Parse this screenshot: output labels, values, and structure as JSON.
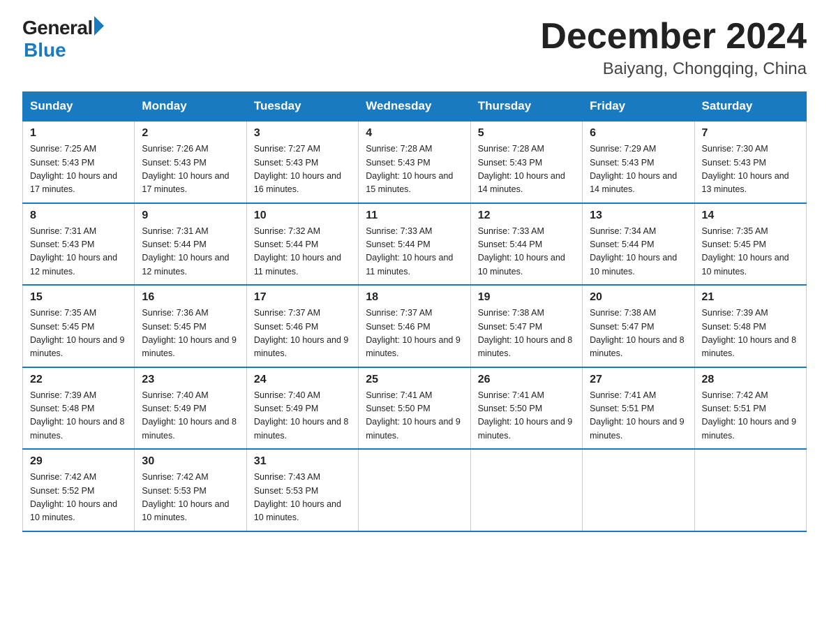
{
  "logo": {
    "general": "General",
    "blue": "Blue"
  },
  "header": {
    "month": "December 2024",
    "location": "Baiyang, Chongqing, China"
  },
  "days_of_week": [
    "Sunday",
    "Monday",
    "Tuesday",
    "Wednesday",
    "Thursday",
    "Friday",
    "Saturday"
  ],
  "weeks": [
    [
      {
        "day": "1",
        "sunrise": "7:25 AM",
        "sunset": "5:43 PM",
        "daylight": "10 hours and 17 minutes."
      },
      {
        "day": "2",
        "sunrise": "7:26 AM",
        "sunset": "5:43 PM",
        "daylight": "10 hours and 17 minutes."
      },
      {
        "day": "3",
        "sunrise": "7:27 AM",
        "sunset": "5:43 PM",
        "daylight": "10 hours and 16 minutes."
      },
      {
        "day": "4",
        "sunrise": "7:28 AM",
        "sunset": "5:43 PM",
        "daylight": "10 hours and 15 minutes."
      },
      {
        "day": "5",
        "sunrise": "7:28 AM",
        "sunset": "5:43 PM",
        "daylight": "10 hours and 14 minutes."
      },
      {
        "day": "6",
        "sunrise": "7:29 AM",
        "sunset": "5:43 PM",
        "daylight": "10 hours and 14 minutes."
      },
      {
        "day": "7",
        "sunrise": "7:30 AM",
        "sunset": "5:43 PM",
        "daylight": "10 hours and 13 minutes."
      }
    ],
    [
      {
        "day": "8",
        "sunrise": "7:31 AM",
        "sunset": "5:43 PM",
        "daylight": "10 hours and 12 minutes."
      },
      {
        "day": "9",
        "sunrise": "7:31 AM",
        "sunset": "5:44 PM",
        "daylight": "10 hours and 12 minutes."
      },
      {
        "day": "10",
        "sunrise": "7:32 AM",
        "sunset": "5:44 PM",
        "daylight": "10 hours and 11 minutes."
      },
      {
        "day": "11",
        "sunrise": "7:33 AM",
        "sunset": "5:44 PM",
        "daylight": "10 hours and 11 minutes."
      },
      {
        "day": "12",
        "sunrise": "7:33 AM",
        "sunset": "5:44 PM",
        "daylight": "10 hours and 10 minutes."
      },
      {
        "day": "13",
        "sunrise": "7:34 AM",
        "sunset": "5:44 PM",
        "daylight": "10 hours and 10 minutes."
      },
      {
        "day": "14",
        "sunrise": "7:35 AM",
        "sunset": "5:45 PM",
        "daylight": "10 hours and 10 minutes."
      }
    ],
    [
      {
        "day": "15",
        "sunrise": "7:35 AM",
        "sunset": "5:45 PM",
        "daylight": "10 hours and 9 minutes."
      },
      {
        "day": "16",
        "sunrise": "7:36 AM",
        "sunset": "5:45 PM",
        "daylight": "10 hours and 9 minutes."
      },
      {
        "day": "17",
        "sunrise": "7:37 AM",
        "sunset": "5:46 PM",
        "daylight": "10 hours and 9 minutes."
      },
      {
        "day": "18",
        "sunrise": "7:37 AM",
        "sunset": "5:46 PM",
        "daylight": "10 hours and 9 minutes."
      },
      {
        "day": "19",
        "sunrise": "7:38 AM",
        "sunset": "5:47 PM",
        "daylight": "10 hours and 8 minutes."
      },
      {
        "day": "20",
        "sunrise": "7:38 AM",
        "sunset": "5:47 PM",
        "daylight": "10 hours and 8 minutes."
      },
      {
        "day": "21",
        "sunrise": "7:39 AM",
        "sunset": "5:48 PM",
        "daylight": "10 hours and 8 minutes."
      }
    ],
    [
      {
        "day": "22",
        "sunrise": "7:39 AM",
        "sunset": "5:48 PM",
        "daylight": "10 hours and 8 minutes."
      },
      {
        "day": "23",
        "sunrise": "7:40 AM",
        "sunset": "5:49 PM",
        "daylight": "10 hours and 8 minutes."
      },
      {
        "day": "24",
        "sunrise": "7:40 AM",
        "sunset": "5:49 PM",
        "daylight": "10 hours and 8 minutes."
      },
      {
        "day": "25",
        "sunrise": "7:41 AM",
        "sunset": "5:50 PM",
        "daylight": "10 hours and 9 minutes."
      },
      {
        "day": "26",
        "sunrise": "7:41 AM",
        "sunset": "5:50 PM",
        "daylight": "10 hours and 9 minutes."
      },
      {
        "day": "27",
        "sunrise": "7:41 AM",
        "sunset": "5:51 PM",
        "daylight": "10 hours and 9 minutes."
      },
      {
        "day": "28",
        "sunrise": "7:42 AM",
        "sunset": "5:51 PM",
        "daylight": "10 hours and 9 minutes."
      }
    ],
    [
      {
        "day": "29",
        "sunrise": "7:42 AM",
        "sunset": "5:52 PM",
        "daylight": "10 hours and 10 minutes."
      },
      {
        "day": "30",
        "sunrise": "7:42 AM",
        "sunset": "5:53 PM",
        "daylight": "10 hours and 10 minutes."
      },
      {
        "day": "31",
        "sunrise": "7:43 AM",
        "sunset": "5:53 PM",
        "daylight": "10 hours and 10 minutes."
      },
      null,
      null,
      null,
      null
    ]
  ]
}
